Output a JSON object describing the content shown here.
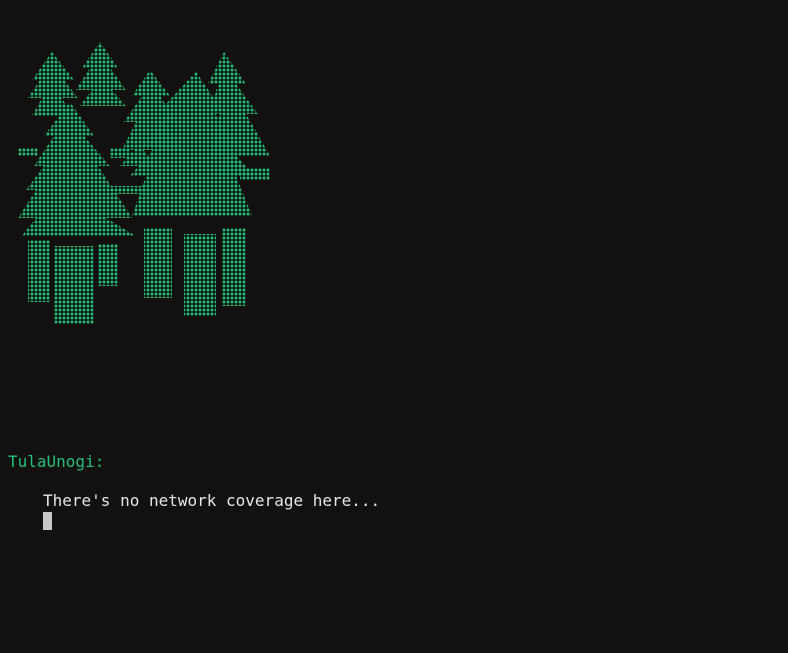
{
  "colors": {
    "background": "#12110f",
    "art_dots": "#22c07a",
    "speaker_name": "#22c07a",
    "message_text": "#e6e6e6",
    "cursor": "#c8c8c8"
  },
  "art": {
    "icon": "pixel-forest-icon"
  },
  "dialog": {
    "speaker": "TulaUnogi:",
    "message": "There's no network coverage here..."
  }
}
